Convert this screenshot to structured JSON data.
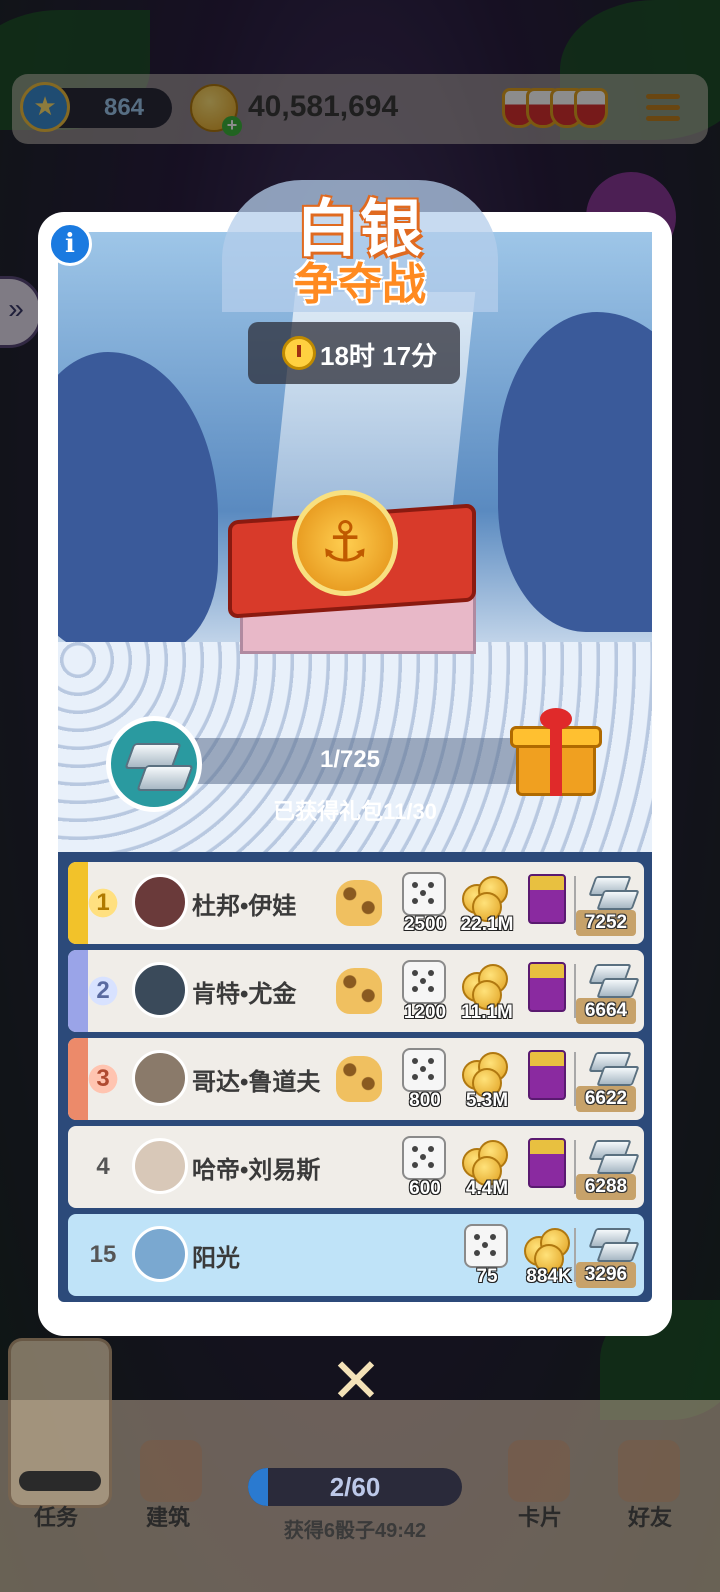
{
  "topbar": {
    "level": "864",
    "coins": "40,581,694",
    "shield_count": 4
  },
  "event": {
    "title_line1": "白银",
    "title_line2": "争夺战",
    "timer": "18时 17分",
    "progress_text": "1/725",
    "progress_fraction": 0.0014,
    "packs_text": "已获得礼包11/30"
  },
  "leaderboard": [
    {
      "rank": "1",
      "name": "杜邦•伊娃",
      "has_cat": true,
      "dice": "2500",
      "coins": "22.1M",
      "has_pack": true,
      "score": "7252",
      "tag_color": "#f2c22a",
      "avatar_color": "#6a3a3a"
    },
    {
      "rank": "2",
      "name": "肯特•尤金",
      "has_cat": true,
      "dice": "1200",
      "coins": "11.1M",
      "has_pack": true,
      "score": "6664",
      "tag_color": "#9aa4e8",
      "avatar_color": "#3a4a5a"
    },
    {
      "rank": "3",
      "name": "哥达•鲁道夫",
      "has_cat": true,
      "dice": "800",
      "coins": "5.3M",
      "has_pack": true,
      "score": "6622",
      "tag_color": "#ec8a6a",
      "avatar_color": "#8a7a6a"
    },
    {
      "rank": "4",
      "name": "哈帝•刘易斯",
      "has_cat": false,
      "dice": "600",
      "coins": "4.4M",
      "has_pack": true,
      "score": "6288",
      "tag_color": "",
      "avatar_color": "#d8c8b8"
    },
    {
      "rank": "15",
      "name": "阳光",
      "has_cat": false,
      "dice": "75",
      "coins": "884K",
      "has_pack": false,
      "score": "3296",
      "tag_color": "",
      "avatar_color": "#7aa8d0",
      "is_me": true
    }
  ],
  "bottom": {
    "dice_progress": "2/60",
    "dice_fraction": 0.033,
    "dice_timer": "获得6骰子49:42",
    "nav": {
      "tasks": "任务",
      "build": "建筑",
      "cards": "卡片",
      "friends": "好友"
    }
  },
  "icons": {
    "info": "info-icon",
    "close": "close-icon",
    "menu": "menu-icon",
    "silver": "silver-ingot-icon",
    "gift": "gift-box-icon"
  }
}
